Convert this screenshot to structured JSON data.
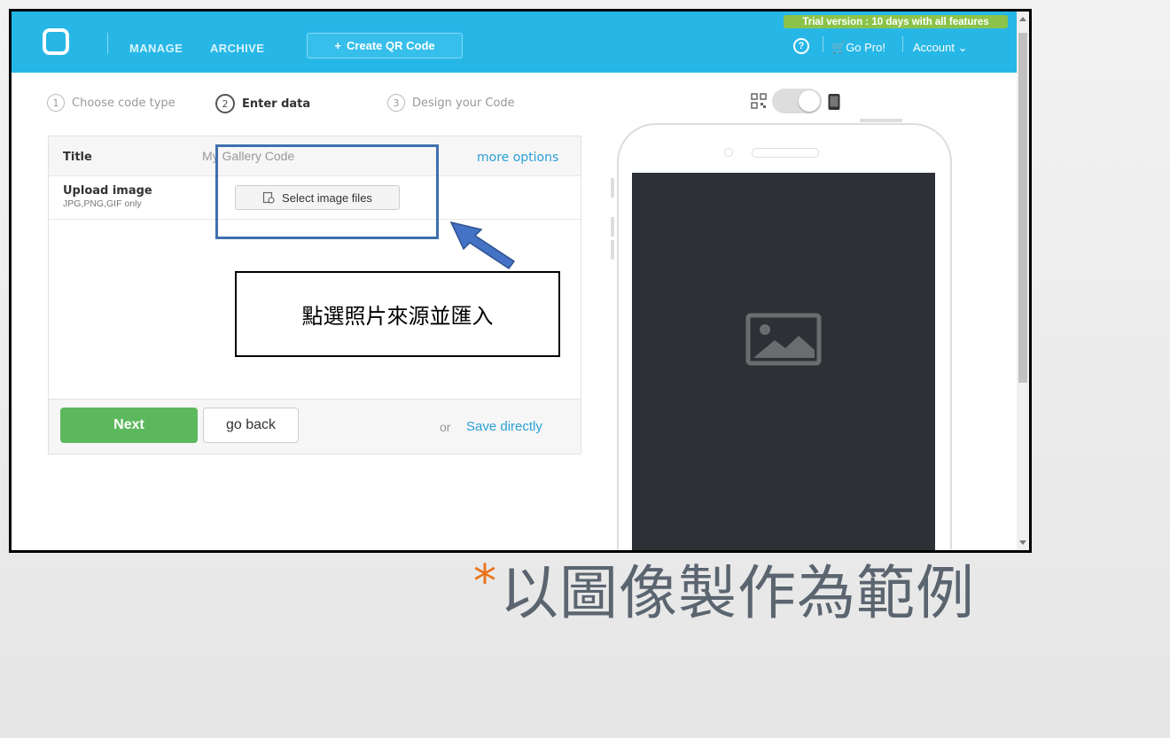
{
  "header": {
    "nav_manage": "MANAGE",
    "nav_archive": "ARCHIVE",
    "create_button": "Create QR Code",
    "trial_banner": "Trial version : 10 days with all features",
    "help": "?",
    "go_pro": "Go Pro!",
    "account": "Account"
  },
  "steps": [
    {
      "num": "1",
      "label": "Choose code type"
    },
    {
      "num": "2",
      "label": "Enter data"
    },
    {
      "num": "3",
      "label": "Design your Code"
    }
  ],
  "form": {
    "title_label": "Title",
    "title_value": "My Gallery Code",
    "more_options": "more options",
    "upload_label": "Upload image",
    "upload_hint": "JPG,PNG,GIF only",
    "select_button": "Select image files"
  },
  "actions": {
    "next": "Next",
    "go_back": "go back",
    "or": "or",
    "save_directly": "Save directly"
  },
  "annotation": {
    "callout_text": "點選照片來源並匯入"
  },
  "caption": {
    "bullet": "*",
    "text": "以圖像製作為範例"
  },
  "colors": {
    "header_bg": "#27b7e7",
    "next_button": "#5cb85c",
    "trial_badge": "#8bc34a",
    "annotation_blue": "#3f6fae",
    "caption_bullet": "#e8731c"
  }
}
